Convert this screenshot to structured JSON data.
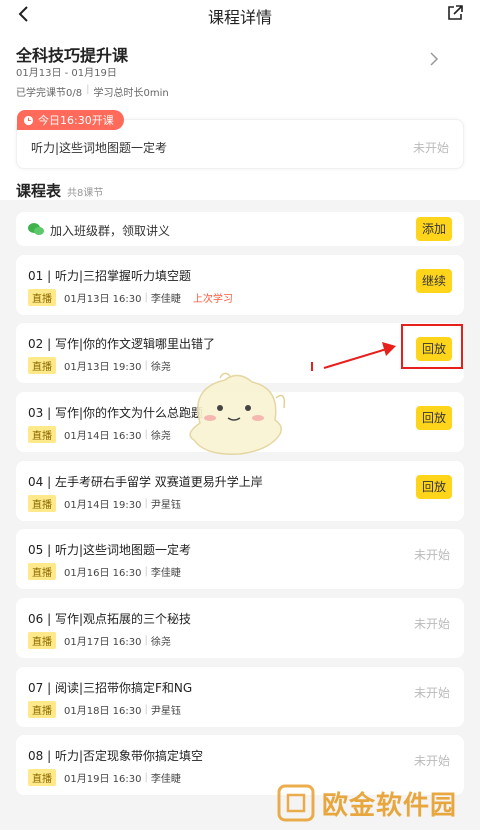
{
  "nav": {
    "title": "课程详情",
    "back_icon": "chevron-left-icon",
    "share_icon": "share-icon"
  },
  "course": {
    "title": "全科技巧提升课",
    "dates": "01月13日 - 01月19日",
    "completed": "已学完课节0/8",
    "duration": "学习总时长0min"
  },
  "today": {
    "badge": "今日16:30开课",
    "lesson": "听力|这些词地图题一定考",
    "status": "未开始"
  },
  "schedule": {
    "title": "课程表",
    "count": "共8课节",
    "group_text": "加入班级群，领取讲义",
    "group_button": "添加"
  },
  "lessons": [
    {
      "name": "01 | 听力|三招掌握听力填空题",
      "tag": "直播",
      "time": "01月13日 16:30",
      "teacher": "李佳睫",
      "extra": "上次学习",
      "action": "继续"
    },
    {
      "name": "02 | 写作|你的作文逻辑哪里出错了",
      "tag": "直播",
      "time": "01月13日 19:30",
      "teacher": "徐尧",
      "action": "回放"
    },
    {
      "name": "03 | 写作|你的作文为什么总跑题",
      "tag": "直播",
      "time": "01月14日 16:30",
      "teacher": "徐尧",
      "action": "回放"
    },
    {
      "name": "04 | 左手考研右手留学 双赛道更易升学上岸",
      "tag": "直播",
      "time": "01月14日 19:30",
      "teacher": "尹星钰",
      "action": "回放"
    },
    {
      "name": "05 | 听力|这些词地图题一定考",
      "tag": "直播",
      "time": "01月16日 16:30",
      "teacher": "李佳睫",
      "status": "未开始"
    },
    {
      "name": "06 | 写作|观点拓展的三个秘技",
      "tag": "直播",
      "time": "01月17日 16:30",
      "teacher": "徐尧",
      "status": "未开始"
    },
    {
      "name": "07 | 阅读|三招带你搞定F和NG",
      "tag": "直播",
      "time": "01月18日 16:30",
      "teacher": "尹星钰",
      "status": "未开始"
    },
    {
      "name": "08 | 听力|否定现象带你搞定填空",
      "tag": "直播",
      "time": "01月19日 16:30",
      "teacher": "李佳睫",
      "status": "未开始"
    }
  ],
  "watermark": {
    "text": "欧金软件园"
  },
  "colors": {
    "accent": "#ffd51c",
    "badge": "#ff6a5a",
    "highlight": "#e8201c"
  }
}
